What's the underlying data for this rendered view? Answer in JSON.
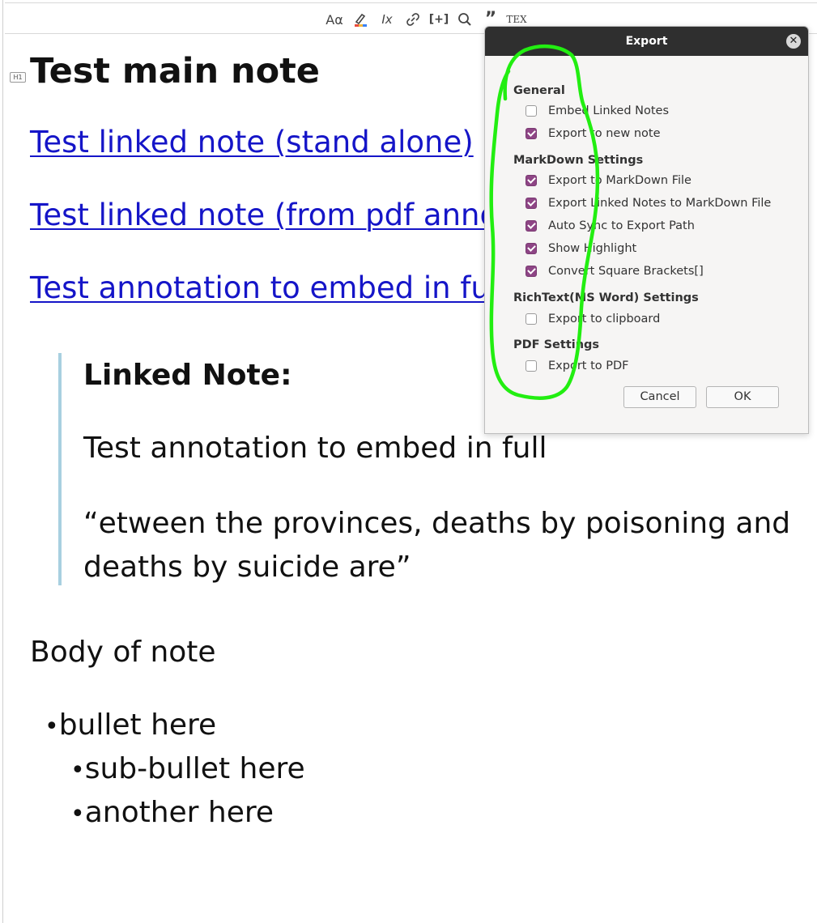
{
  "toolbar": {
    "buttons": [
      {
        "name": "text-format-icon",
        "glyph": "Aα"
      },
      {
        "name": "highlight-icon"
      },
      {
        "name": "clear-format-icon",
        "glyph": "Ix"
      },
      {
        "name": "link-icon"
      },
      {
        "name": "insert-citation-icon",
        "glyph": "[+]"
      },
      {
        "name": "search-icon"
      },
      {
        "name": "quote-icon",
        "glyph": "”"
      },
      {
        "name": "tex-icon",
        "glyph": "TEX"
      }
    ]
  },
  "note": {
    "heading_tag": "H1",
    "title": "Test main note",
    "links": [
      "Test linked note (stand alone)",
      "Test linked note (from pdf anno",
      "Test annotation to embed in ful"
    ],
    "blockquote": {
      "heading": "Linked Note:",
      "annotation_title": "Test annotation to embed in full",
      "quote": "“etween the provinces, deaths by poisoning and deaths by suicide are”"
    },
    "body": "Body of note",
    "bullets": [
      {
        "text": "bullet here",
        "level": 1
      },
      {
        "text": "sub-bullet here",
        "level": 2
      },
      {
        "text": "another here",
        "level": 2
      }
    ]
  },
  "dialog": {
    "title": "Export",
    "close_glyph": "✕",
    "sections": {
      "general": {
        "label": "General",
        "options": [
          {
            "label": "Embed Linked Notes",
            "checked": false
          },
          {
            "label": "Export to new note",
            "checked": true
          }
        ]
      },
      "markdown": {
        "label": "MarkDown Settings",
        "options": [
          {
            "label": "Export to MarkDown File",
            "checked": true
          },
          {
            "label": "Export Linked Notes to MarkDown File",
            "checked": true
          },
          {
            "label": "Auto Sync to Export Path",
            "checked": true
          },
          {
            "label": "Show Highlight",
            "checked": true
          },
          {
            "label": "Convert Square Brackets[]",
            "checked": true
          }
        ]
      },
      "richtext": {
        "label": "RichText(MS Word) Settings",
        "options": [
          {
            "label": "Export to clipboard",
            "checked": false
          }
        ]
      },
      "pdf": {
        "label": "PDF Settings",
        "options": [
          {
            "label": "Export to PDF",
            "checked": false
          }
        ]
      }
    },
    "cancel_label": "Cancel",
    "ok_label": "OK",
    "checkbox_color": "#8e4585"
  },
  "annotation_color": "#22ee11"
}
